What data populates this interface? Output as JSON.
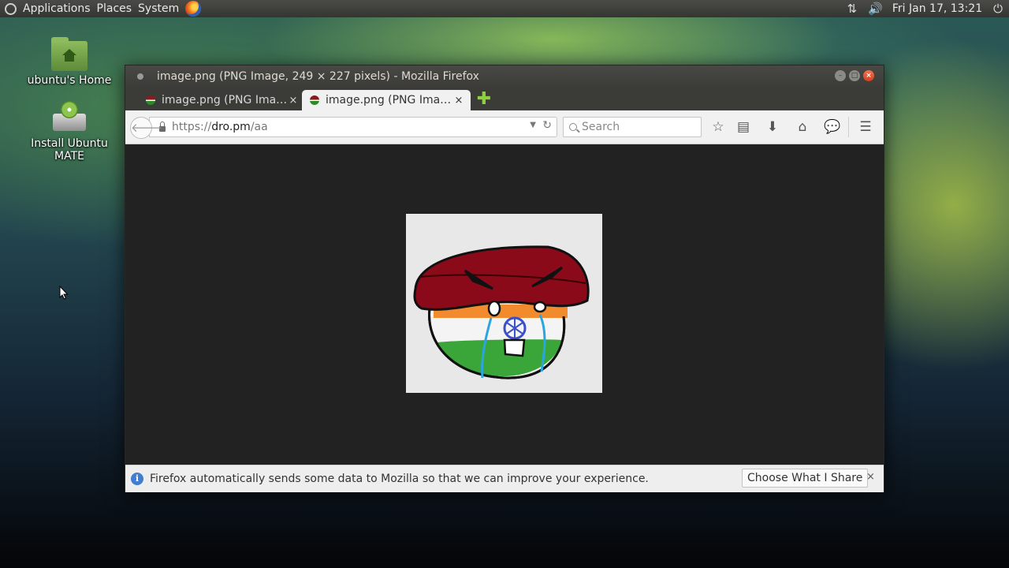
{
  "panel": {
    "menus": [
      "Applications",
      "Places",
      "System"
    ],
    "clock": "Fri Jan 17, 13:21"
  },
  "desktop": {
    "icons": [
      {
        "label": "ubuntu's Home",
        "icon": "home-folder-icon"
      },
      {
        "label": "Install Ubuntu MATE",
        "icon": "install-drive-icon"
      }
    ]
  },
  "window": {
    "title": "image.png (PNG Image, 249 × 227 pixels) - Mozilla Firefox",
    "tabs": [
      {
        "label": "image.png (PNG Ima…",
        "active": false
      },
      {
        "label": "image.png (PNG Ima…",
        "active": true
      }
    ],
    "close_glyph": "×",
    "new_tab_glyph": "✚"
  },
  "navbar": {
    "url_prefix": "https://",
    "url_host": "dro.pm",
    "url_path": "/aa",
    "search_placeholder": "Search"
  },
  "image": {
    "description_colors": {
      "background": "#e8e8e8",
      "cap": "#8b0a1a",
      "saffron": "#f28a2e",
      "green": "#3aa63a",
      "chakra": "#3b4fc8",
      "tears": "#2aa5e0"
    }
  },
  "notification": {
    "message": "Firefox automatically sends some data to Mozilla so that we can improve your experience.",
    "button": "Choose What I Share",
    "close_glyph": "×"
  },
  "colors": {
    "accent_newtab": "#8ed03f",
    "close_button": "#e2562f",
    "info": "#3f7ed1"
  }
}
